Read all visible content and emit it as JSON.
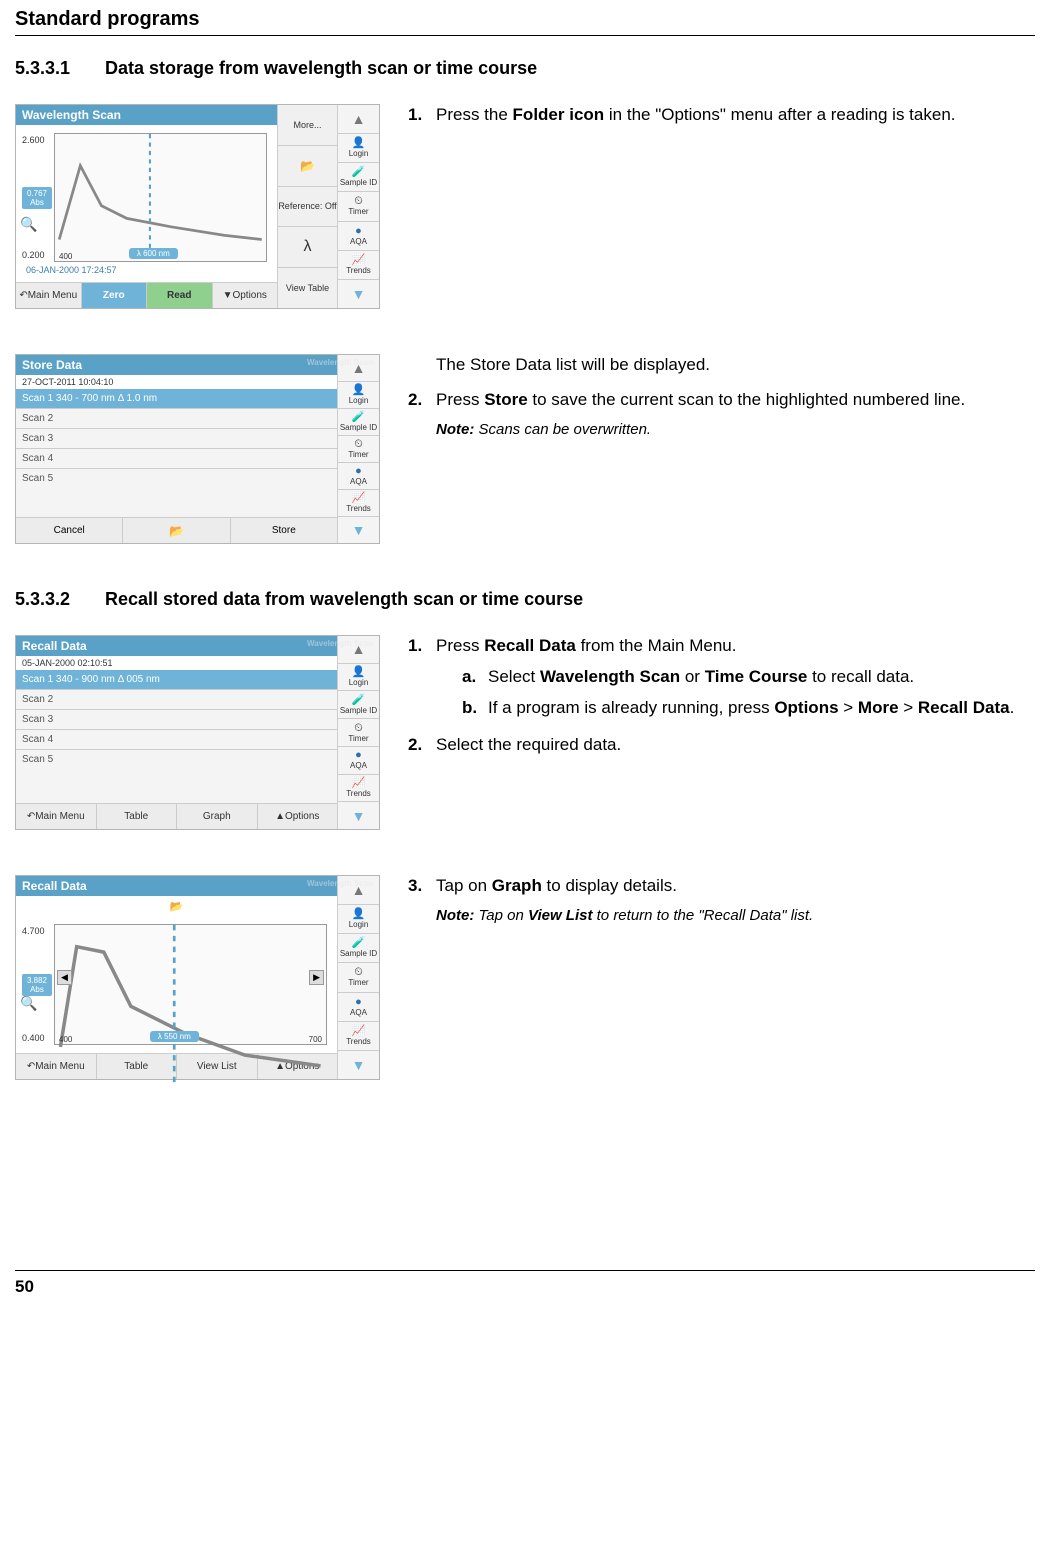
{
  "header": {
    "title": "Standard programs"
  },
  "section1": {
    "num": "5.3.3.1",
    "title": "Data storage from wavelength scan or time course"
  },
  "section2": {
    "num": "5.3.3.2",
    "title": "Recall stored data from wavelength scan or time course"
  },
  "step1": {
    "num": "1.",
    "prefix": "Press the ",
    "bold": "Folder icon",
    "suffix": " in the \"Options\" menu after a reading is taken."
  },
  "block2": {
    "intro": "The Store Data list will be displayed.",
    "num": "2.",
    "prefix": "Press ",
    "bold": "Store",
    "suffix": " to save the current scan to the highlighted numbered line.",
    "note_label": "Note:",
    "note": " Scans can be overwritten."
  },
  "block3": {
    "s1num": "1.",
    "s1prefix": "Press ",
    "s1bold": "Recall Data",
    "s1suffix": " from the Main Menu.",
    "a_num": "a.",
    "a_prefix": "Select ",
    "a_b1": "Wavelength Scan",
    "a_mid": " or ",
    "a_b2": "Time Course",
    "a_suffix": " to recall data.",
    "b_num": "b.",
    "b_prefix": "If a program is already running, press ",
    "b_b1": "Options",
    "b_g1": " > ",
    "b_b2": "More",
    "b_g2": " > ",
    "b_b3": "Recall Data",
    "b_suffix": ".",
    "s2num": "2.",
    "s2txt": "Select the required data."
  },
  "block4": {
    "num": "3.",
    "prefix": "Tap on ",
    "bold": "Graph",
    "suffix": " to display details.",
    "note_label": "Note:",
    "note_pre": " Tap on ",
    "note_bold": "View List",
    "note_post": " to return to the \"Recall Data\" list."
  },
  "footer": {
    "page": "50"
  },
  "shot_common": {
    "login": "Login",
    "sampleid": "Sample ID",
    "timer": "Timer",
    "aqa": "AQA",
    "trends": "Trends"
  },
  "shot1": {
    "title": "Wavelength Scan",
    "more": "More...",
    "ref": "Reference: Off",
    "lambda": "λ",
    "viewtable": "View Table",
    "options": "Options",
    "y_hi": "2.600",
    "y_lo": "0.200",
    "abs": "0.767 Abs",
    "x_lo": "400",
    "lambda_pill": "λ 600 nm",
    "date": "06-JAN-2000  17:24:57",
    "main": "Main Menu",
    "zero": "Zero",
    "read": "Read"
  },
  "shot2": {
    "title": "Store Data",
    "dt": "27-OCT-2011  10:04:10",
    "range": "Scan 1     340 - 700 nm Δ 1.0 nm",
    "s2": "Scan 2",
    "s3": "Scan 3",
    "s4": "Scan 4",
    "s5": "Scan 5",
    "cancel": "Cancel",
    "store": "Store"
  },
  "shot3": {
    "title": "Recall Data",
    "dt": "05-JAN-2000  02:10:51",
    "range": "Scan 1     340 - 900 nm Δ 005 nm",
    "s2": "Scan 2",
    "s3": "Scan 3",
    "s4": "Scan 4",
    "s5": "Scan 5",
    "main": "Main Menu",
    "table": "Table",
    "graph": "Graph",
    "options": "Options"
  },
  "shot4": {
    "title": "Recall Data",
    "y_hi": "4.700",
    "y_lo": "0.400",
    "abs": "3.882 Abs",
    "x_lo": "400",
    "x_hi": "700",
    "lambda_pill": "λ 550 nm",
    "main": "Main Menu",
    "table": "Table",
    "viewlist": "View List",
    "options": "Options"
  }
}
